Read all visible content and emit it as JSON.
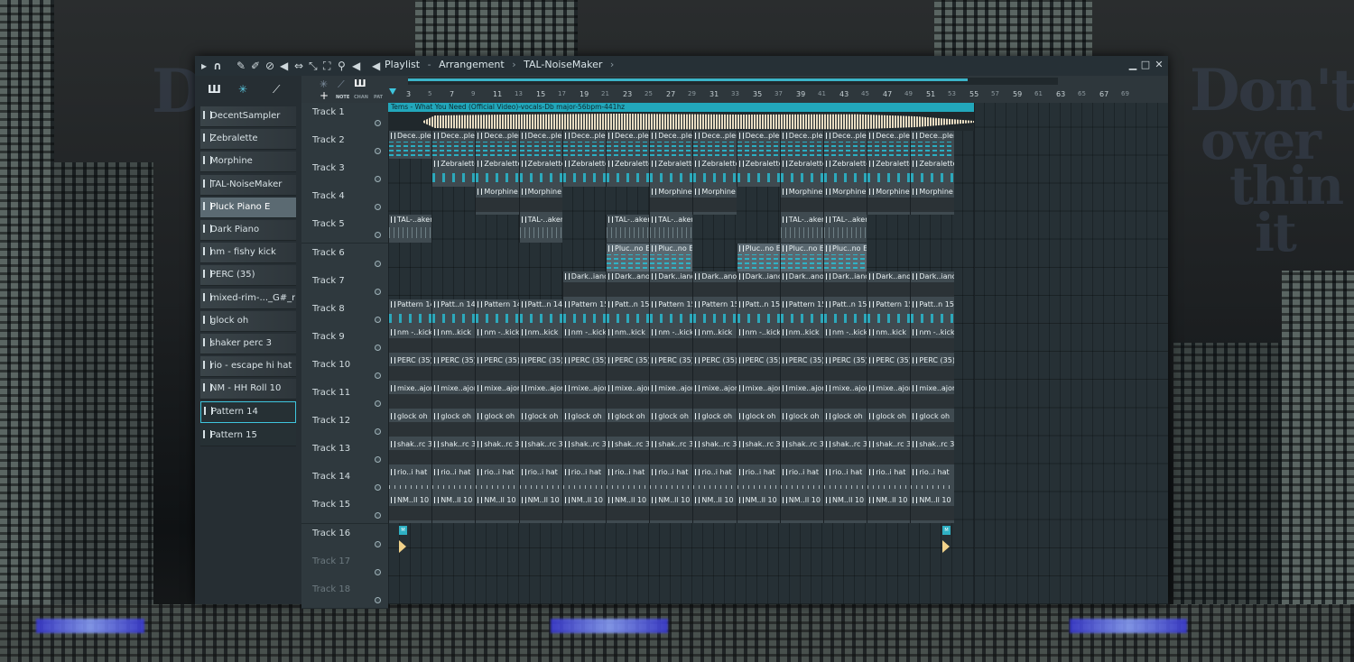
{
  "window": {
    "title_playlist": "Playlist",
    "title_arrangement": "Arrangement",
    "title_plugin": "TAL-NoiseMaker",
    "title_sep": "-",
    "title_arrow": "›",
    "minimize": "▁",
    "maximize": "□",
    "close": "✕"
  },
  "browser": {
    "tools": [
      "piano-icon",
      "waveform-icon",
      "automation-icon"
    ],
    "channels": [
      {
        "label": "DecentSampler"
      },
      {
        "label": "Zebralette"
      },
      {
        "label": "Morphine"
      },
      {
        "label": "TAL-NoiseMaker"
      },
      {
        "label": "Pluck Piano E",
        "selected": true
      },
      {
        "label": "Dark Piano"
      },
      {
        "label": "nm - fishy kick"
      },
      {
        "label": "PERC (35)"
      },
      {
        "label": "mixed-rim-..._G#_major"
      },
      {
        "label": "glock oh"
      },
      {
        "label": "shaker perc 3"
      },
      {
        "label": "rio - escape hi hat"
      },
      {
        "label": "NM - HH Roll 10"
      },
      {
        "label": "Pattern 14",
        "outlined": true
      },
      {
        "label": "Pattern 15"
      }
    ]
  },
  "toolbar": {
    "add": "+",
    "note": "NOTE",
    "chan": "CHAN",
    "pat": "PAT"
  },
  "ruler": [
    "3",
    "5",
    "7",
    "9",
    "11",
    "13",
    "15",
    "17",
    "19",
    "21",
    "23",
    "25",
    "27",
    "29",
    "31",
    "33",
    "35",
    "37",
    "39",
    "41",
    "43",
    "45",
    "47",
    "49",
    "51",
    "53",
    "55",
    "57",
    "59",
    "61",
    "63",
    "65",
    "67",
    "69"
  ],
  "tracks": [
    "Track 1",
    "Track 2",
    "Track 3",
    "Track 4",
    "Track 5",
    "Track 6",
    "Track 7",
    "Track 8",
    "Track 9",
    "Track 10",
    "Track 11",
    "Track 12",
    "Track 13",
    "Track 14",
    "Track 15",
    "Track 16",
    "Track 17",
    "Track 18"
  ],
  "audio_clip": "Tems - What You Need (Official Video)-vocals-Db major-56bpm-441hz",
  "lanes": {
    "t2": "Dece..pler",
    "t3": "Zebralette",
    "t4": "Morphine",
    "t5": "TAL-..aker",
    "t6": "Pluc..no E",
    "t7a": "Dark..iano",
    "t7b": "Dark..ano",
    "t8a": "Pattern 14",
    "t8b": "Patt..n 14",
    "t8c": "Patt..n 14",
    "t8d": "Pattern 15",
    "t8e": "Patt..n 15",
    "t9a": "nm -..kick",
    "t9b": "nm..kick",
    "t10": "PERC (35)",
    "t11": "mixe..ajor",
    "t12": "glock oh",
    "t13": "shak..rc 3",
    "t14": "rio..i hat",
    "t15": "NM..ll 10",
    "marker": "M"
  },
  "background_text": {
    "left": "Do o",
    "right1": "Don't",
    "right2": "over",
    "right3": "thin",
    "right4": "it"
  }
}
